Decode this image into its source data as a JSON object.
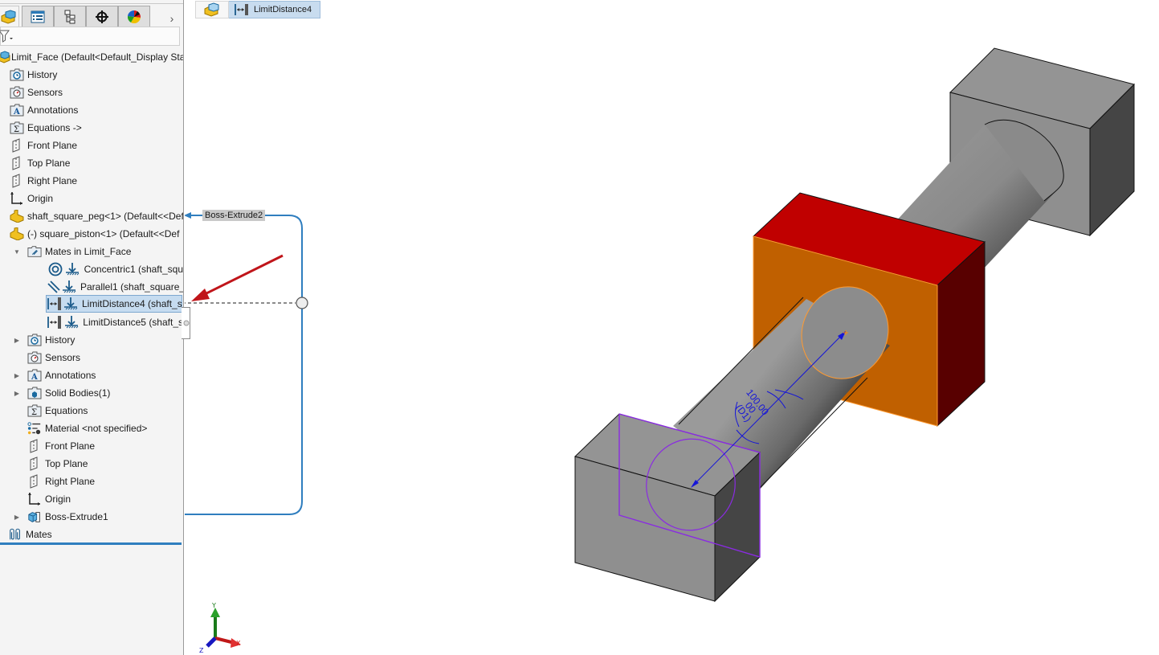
{
  "feature_manager": {
    "tabs": [
      {
        "name": "featuremanager-tree",
        "icon": "assembly-icon",
        "active": true
      },
      {
        "name": "property-manager",
        "icon": "property-list-icon",
        "active": false
      },
      {
        "name": "configuration-manager",
        "icon": "configuration-tree-icon",
        "active": false
      },
      {
        "name": "dimxpert-manager",
        "icon": "crosshair-target-icon",
        "active": false
      },
      {
        "name": "display-manager",
        "icon": "color-ball-icon",
        "active": false
      }
    ],
    "more_tabs_glyph": "›",
    "filter_icon": "filter-funnel-icon",
    "tree": {
      "root": {
        "label": "Limit_Face  (Default<Default_Display Stat",
        "icon": "assembly-icon"
      },
      "items": [
        {
          "label": "History",
          "icon": "history-folder-icon"
        },
        {
          "label": "Sensors",
          "icon": "sensors-folder-icon"
        },
        {
          "label": "Annotations",
          "icon": "annotations-folder-icon"
        },
        {
          "label": "Equations ->",
          "icon": "equations-folder-icon"
        },
        {
          "label": "Front Plane",
          "icon": "plane-icon"
        },
        {
          "label": "Top Plane",
          "icon": "plane-icon"
        },
        {
          "label": "Right Plane",
          "icon": "plane-icon"
        },
        {
          "label": "Origin",
          "icon": "origin-icon"
        },
        {
          "label": "shaft_square_peg<1> (Default<<Def",
          "icon": "part-icon"
        },
        {
          "label": "(-) square_piston<1> (Default<<Def",
          "icon": "part-icon"
        }
      ],
      "mates_folder": {
        "label": "Mates in Limit_Face",
        "icon": "mates-folder-icon",
        "expanded": true
      },
      "mates": [
        {
          "label": "Concentric1 (shaft_squ",
          "icon": "concentric-mate-icon",
          "selected": false
        },
        {
          "label": "Parallel1 (shaft_square_",
          "icon": "parallel-mate-icon",
          "selected": false
        },
        {
          "label": "LimitDistance4 (shaft_s",
          "icon": "limit-distance-mate-icon",
          "selected": true
        },
        {
          "label": "LimitDistance5 (shaft_s",
          "icon": "limit-distance-mate-icon",
          "selected": false
        }
      ],
      "piston_children": [
        {
          "label": "History",
          "icon": "history-folder-icon",
          "expandable": true
        },
        {
          "label": "Sensors",
          "icon": "sensors-folder-icon",
          "expandable": false
        },
        {
          "label": "Annotations",
          "icon": "annotations-folder-icon",
          "expandable": true
        },
        {
          "label": "Solid Bodies(1)",
          "icon": "solid-bodies-folder-icon",
          "expandable": true
        },
        {
          "label": "Equations",
          "icon": "equations-folder-icon",
          "expandable": false
        },
        {
          "label": "Material <not specified>",
          "icon": "material-icon",
          "expandable": false
        },
        {
          "label": "Front Plane",
          "icon": "plane-icon",
          "expandable": false
        },
        {
          "label": "Top Plane",
          "icon": "plane-icon",
          "expandable": false
        },
        {
          "label": "Right Plane",
          "icon": "plane-icon",
          "expandable": false
        },
        {
          "label": "Origin",
          "icon": "origin-icon",
          "expandable": false
        },
        {
          "label": "Boss-Extrude1",
          "icon": "boss-extrude-icon",
          "expandable": true
        }
      ],
      "mates_root": {
        "label": "Mates",
        "icon": "mates-paperclip-icon"
      }
    }
  },
  "breadcrumb": {
    "root_icon": "assembly-icon",
    "item_icon": "limit-distance-mate-icon",
    "item_label": "LimitDistance4"
  },
  "callouts": {
    "boss_extrude2_label": "Boss-Extrude2"
  },
  "viewport": {
    "dimension": {
      "value": "100.00",
      "line2": "00",
      "line3": "(D1)"
    },
    "triad": {
      "x": "X",
      "y": "Y",
      "z": "Z"
    },
    "colors": {
      "selected_face": "#c06000",
      "selected_top": "#c00000",
      "selected_side": "#580000",
      "body_gray": "#8f8f8f",
      "body_dark": "#454545",
      "dimension": "#1515d8",
      "reference_purple": "#8a2be2",
      "annotation_arrow": "#c0151a",
      "connector_blue": "#2f7ebf"
    }
  }
}
